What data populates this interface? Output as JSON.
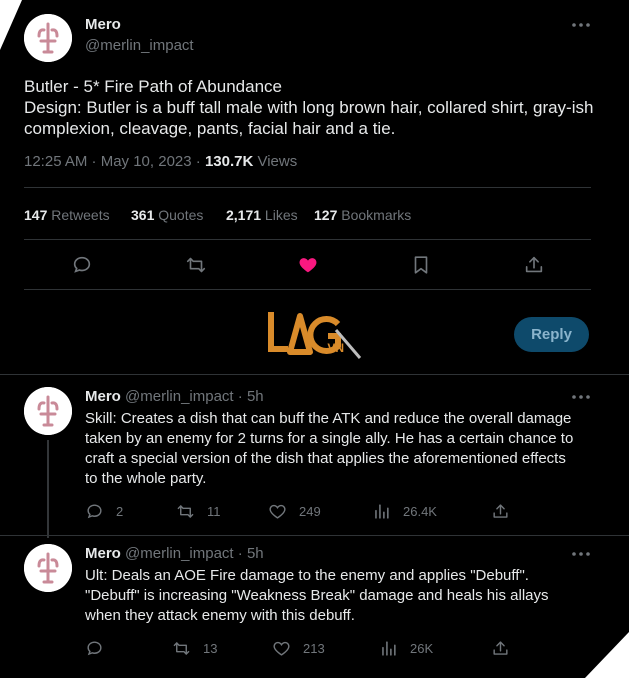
{
  "tweet": {
    "author_name": "Mero",
    "author_handle": "@merlin_impact",
    "text": "Butler - 5* Fire Path of Abundance\nDesign: Butler is a buff tall male with long brown hair, collared shirt, gray-ish complexion, cleavage, pants, facial hair and a tie.",
    "time": "12:25 AM · May 10, 2023 · ",
    "views_count": "130.7K",
    "views_label": " Views",
    "stats": {
      "retweets": {
        "count": "147",
        "label": " Retweets"
      },
      "quotes": {
        "count": "361",
        "label": " Quotes"
      },
      "likes": {
        "count": "2,171",
        "label": " Likes"
      },
      "bookmarks": {
        "count": "127",
        "label": " Bookmarks"
      }
    },
    "liked": true,
    "like_color": "#f91880"
  },
  "reply_button": {
    "label": "Reply"
  },
  "watermark": {
    "text": "LAG.VN"
  },
  "replies": [
    {
      "author_name": "Mero",
      "author_handle": "@merlin_impact",
      "time": " · 5h",
      "text": "Skill: Creates a dish that can buff the ATK and reduce the overall damage\ntaken by an enemy for 2 turns for a single ally. He has a certain chance to\ncraft a special version of the dish that applies the aforementioned effects\nto the whole party.",
      "replies": "2",
      "retweets": "11",
      "likes": "249",
      "views": "26.4K"
    },
    {
      "author_name": "Mero",
      "author_handle": "@merlin_impact",
      "time": " · 5h",
      "text": "Ult: Deals an AOE Fire damage to the enemy and applies \"Debuff\".\n\"Debuff\" is increasing \"Weakness Break\" damage and heals his allays\nwhen they attack enemy with this debuff.",
      "replies": "",
      "retweets": "13",
      "likes": "213",
      "views": "26K"
    }
  ]
}
